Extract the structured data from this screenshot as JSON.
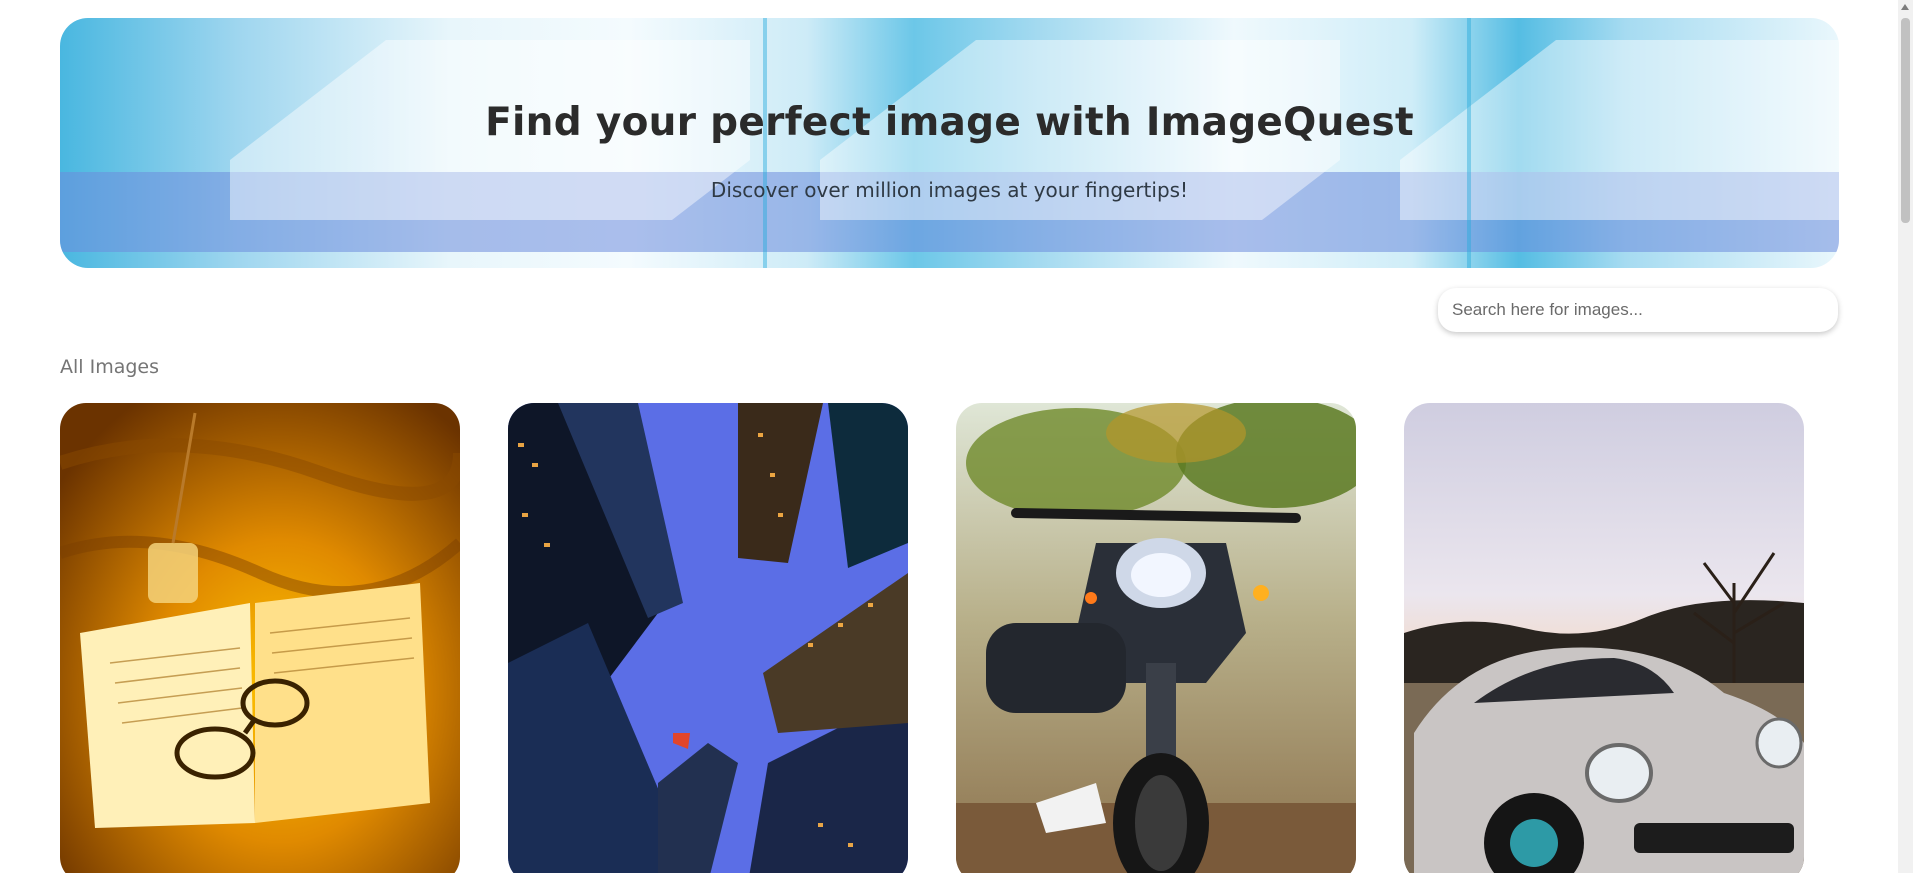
{
  "hero": {
    "title": "Find your perfect image with ImageQuest",
    "subtitle": "Discover over million images at your fingertips!"
  },
  "search": {
    "placeholder": "Search here for images...",
    "value": ""
  },
  "section": {
    "title": "All Images"
  },
  "gallery": {
    "items": [
      {
        "subject": "open-book-with-glasses-photo"
      },
      {
        "subject": "skyscrapers-looking-up-photo"
      },
      {
        "subject": "motorcycle-photo"
      },
      {
        "subject": "silver-sports-car-photo"
      }
    ]
  }
}
